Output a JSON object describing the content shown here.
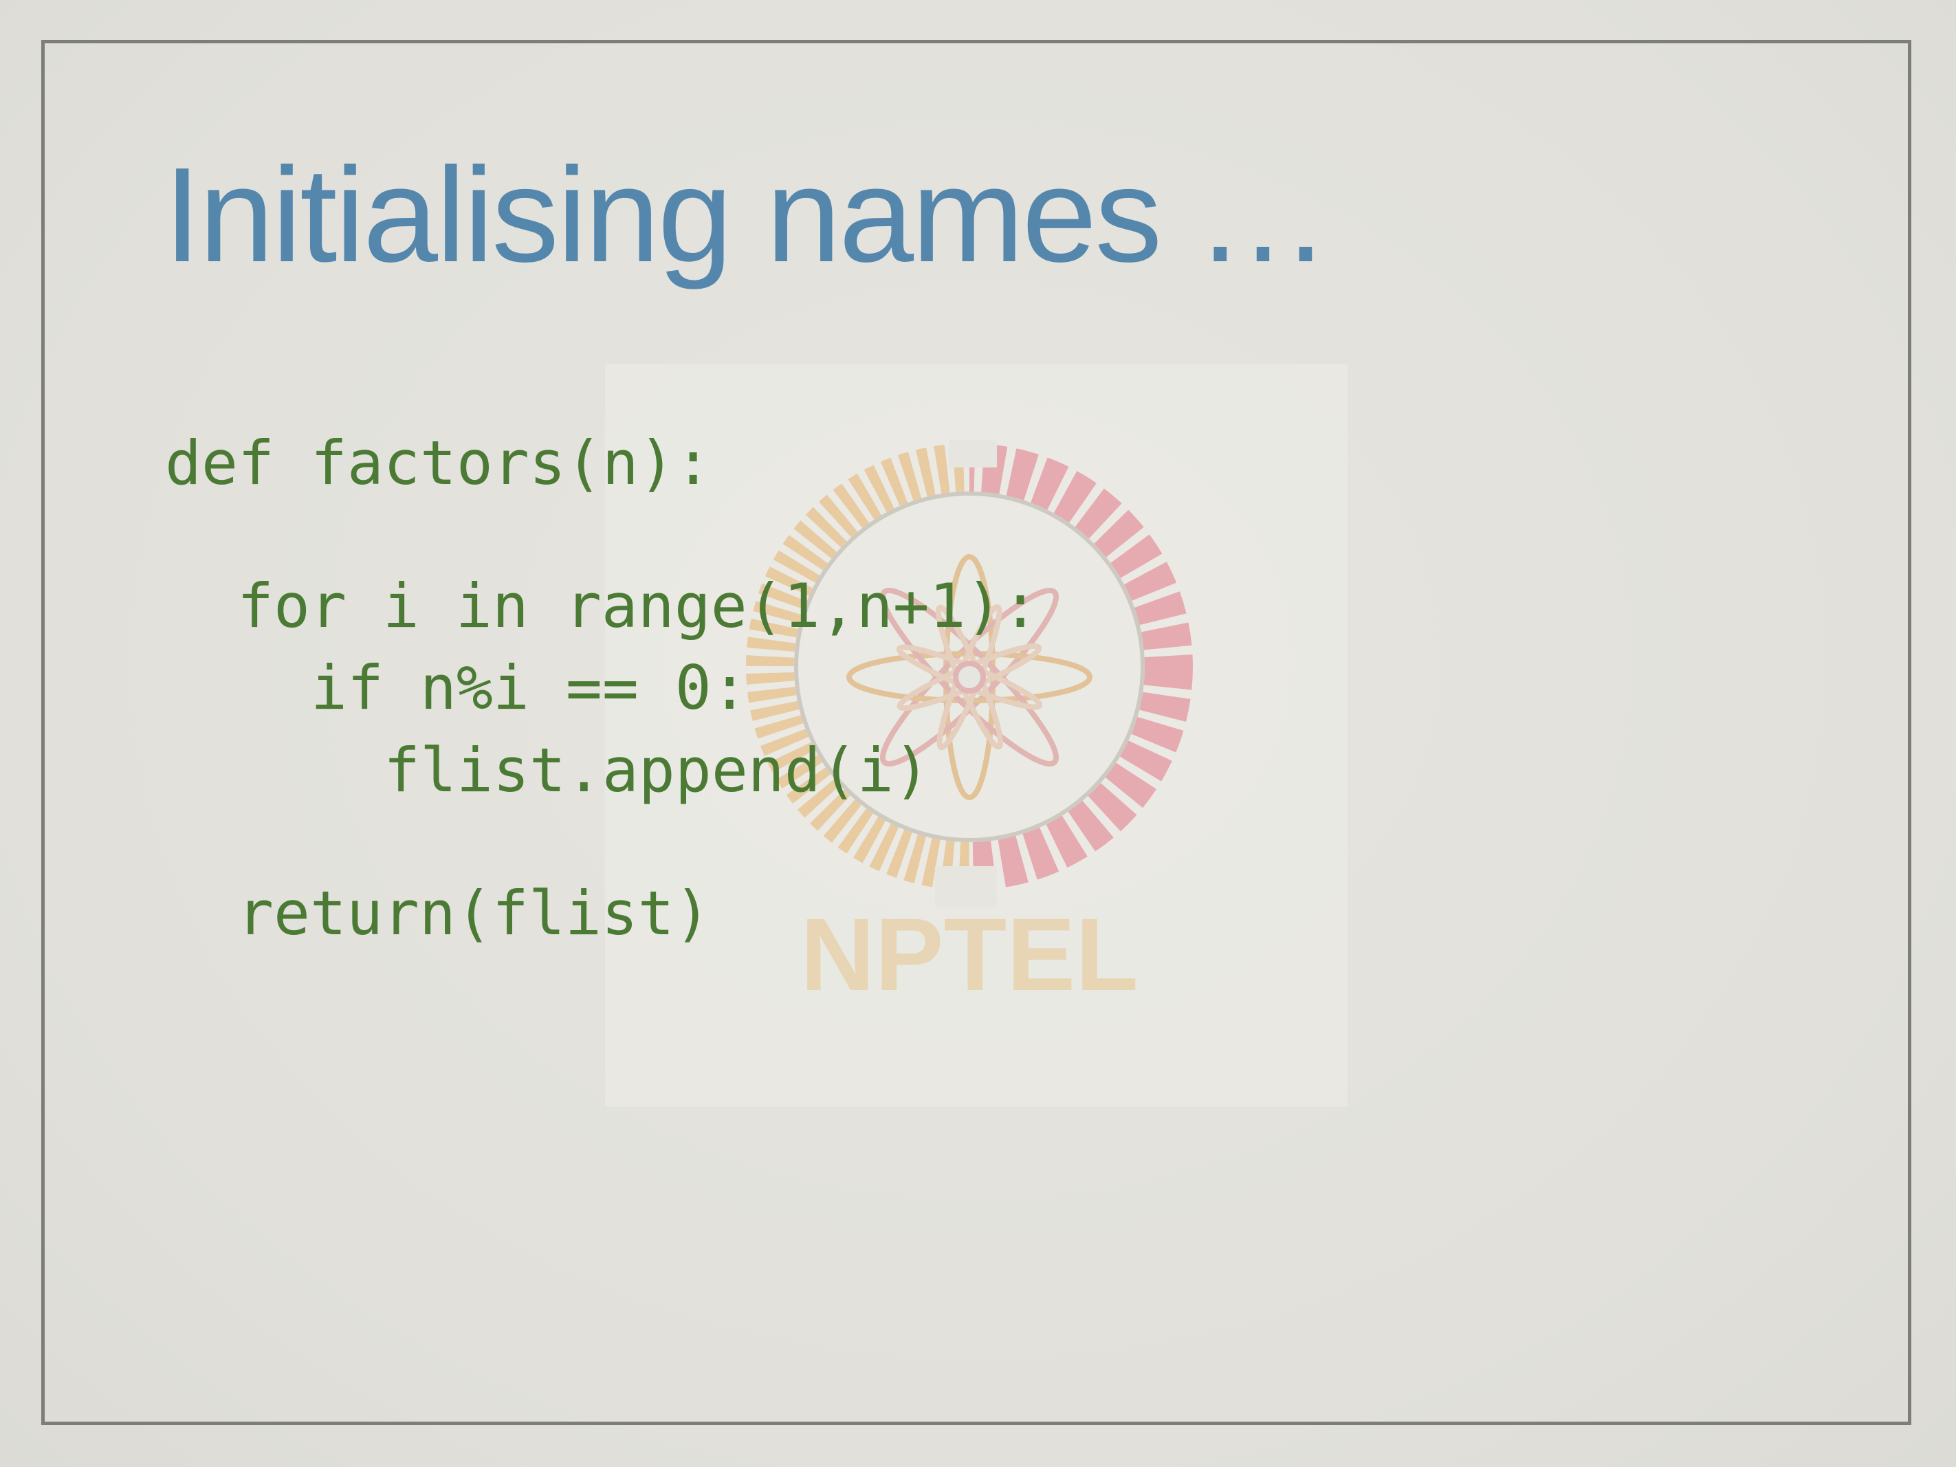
{
  "slide": {
    "title": "Initialising names …",
    "code_lines": [
      "def factors(n):",
      "for i in range(1,n+1):",
      "if n%i == 0:",
      "flist.append(i)",
      "return(flist)"
    ]
  },
  "watermark": {
    "text": "NPTEL",
    "icon": "nptel-logo-icon"
  },
  "colors": {
    "title": "#5587ad",
    "code": "#4b7a35",
    "background": "#e3e2dd",
    "frame": "#7d7d7a"
  }
}
